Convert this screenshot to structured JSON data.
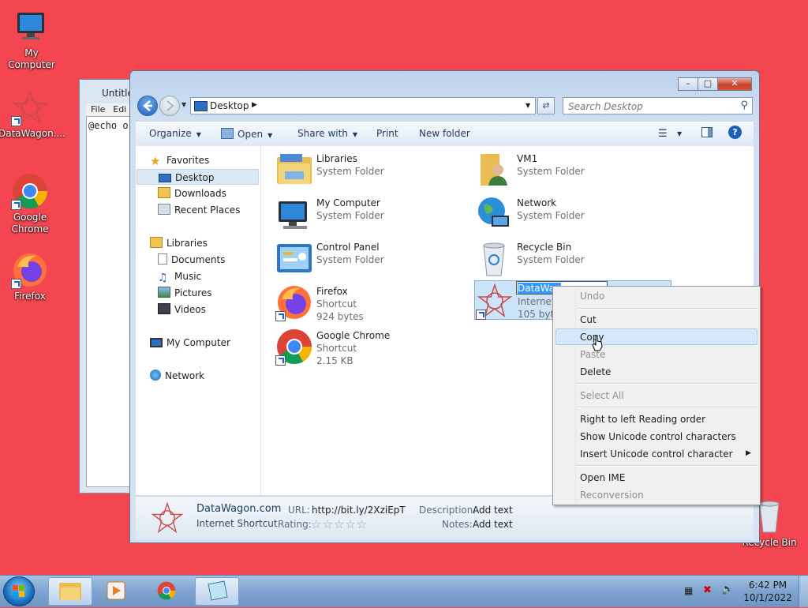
{
  "desktop": {
    "icons": [
      {
        "label": "My Computer"
      },
      {
        "label": "DataWagon...."
      },
      {
        "label": "Google Chrome"
      },
      {
        "label": "Firefox"
      },
      {
        "label": "Recycle Bin"
      }
    ]
  },
  "notepad": {
    "title": "Untitled",
    "menu": [
      "File",
      "Edi"
    ],
    "content": "@echo o"
  },
  "explorer": {
    "address": "Desktop",
    "search_placeholder": "Search Desktop",
    "toolbar": {
      "organize": "Organize",
      "open": "Open",
      "share_with": "Share with",
      "print": "Print",
      "new_folder": "New folder"
    },
    "nav": {
      "favorites": "Favorites",
      "desktop": "Desktop",
      "downloads": "Downloads",
      "recent_places": "Recent Places",
      "libraries": "Libraries",
      "documents": "Documents",
      "music": "Music",
      "pictures": "Pictures",
      "videos": "Videos",
      "my_computer": "My Computer",
      "network": "Network"
    },
    "items": [
      {
        "name": "Libraries",
        "type": "System Folder",
        "size": ""
      },
      {
        "name": "VM1",
        "type": "System Folder",
        "size": ""
      },
      {
        "name": "My Computer",
        "type": "System Folder",
        "size": ""
      },
      {
        "name": "Network",
        "type": "System Folder",
        "size": ""
      },
      {
        "name": "Control Panel",
        "type": "System Folder",
        "size": ""
      },
      {
        "name": "Recycle Bin",
        "type": "System Folder",
        "size": ""
      },
      {
        "name": "Firefox",
        "type": "Shortcut",
        "size": "924 bytes"
      },
      {
        "name": "DataWagon.com",
        "type": "Internet",
        "size": "105 byte"
      },
      {
        "name": "Google Chrome",
        "type": "Shortcut",
        "size": "2.15 KB"
      }
    ],
    "rename_text": "DataWag",
    "details": {
      "name": "DataWagon.com",
      "type": "Internet Shortcut",
      "url_label": "URL:",
      "url": "http://bit.ly/2XziEpT",
      "rating_label": "Rating:",
      "rating_stars": "☆☆☆☆☆",
      "description_label": "Description:",
      "description": "Add text",
      "notes_label": "Notes:",
      "notes": "Add text"
    }
  },
  "context_menu": {
    "undo": "Undo",
    "cut": "Cut",
    "copy": "Copy",
    "paste": "Paste",
    "delete": "Delete",
    "select_all": "Select All",
    "rtl": "Right to left Reading order",
    "show_unicode": "Show Unicode control characters",
    "insert_unicode": "Insert Unicode control character",
    "open_ime": "Open IME",
    "reconversion": "Reconversion"
  },
  "taskbar": {
    "time": "6:42 PM",
    "date": "10/1/2022"
  },
  "colors": {
    "desktop": "#f44651",
    "selection": "#cce4f7",
    "menu_hover": "#d5e7f8"
  }
}
